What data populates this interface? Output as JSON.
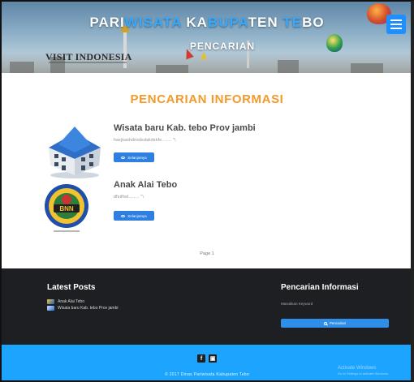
{
  "header": {
    "brand_parts": [
      {
        "text": "PARI",
        "hl": false
      },
      {
        "text": "WISATA",
        "hl": true
      },
      {
        "text": " KA",
        "hl": false
      },
      {
        "text": "BUPA",
        "hl": true
      },
      {
        "text": "TEN ",
        "hl": false
      },
      {
        "text": "TE",
        "hl": true
      },
      {
        "text": "BO",
        "hl": false
      }
    ],
    "subtitle": "PENCARIAN",
    "visit_logo": "VISIT INDONESIA",
    "menu_icon": "hamburger-menu-icon"
  },
  "main": {
    "heading": "PENCARIAN INFORMASI",
    "articles": [
      {
        "title": "Wisata baru Kab. tebo Prov jambi",
        "excerpt": "hasjkashdnsdsdakdskfe....... \"\\",
        "button": "Selanjutnya",
        "thumb": "building-icon"
      },
      {
        "title": "Anak Alai Tebo",
        "excerpt": "dfsdfsd........ \"\\",
        "button": "Selanjutnya",
        "thumb": "bnn-logo-icon"
      }
    ],
    "pagination": "Page 1"
  },
  "footer": {
    "latest_title": "Latest Posts",
    "posts": [
      "Anak Alai Tebo",
      "Wisata baru Kab. tebo Prov jambi"
    ],
    "search_title": "Pencarian Informasi",
    "search_placeholder": "Masukkan Keyword",
    "search_button": "Pencarian",
    "social": [
      "f",
      "▣"
    ],
    "copyright": "© 2017 Dinas Pariwisata Kabupaten Tebo",
    "activate_title": "Activate Windows",
    "activate_sub": "Go to Settings to activate Windows."
  },
  "colors": {
    "accent_orange": "#f39a2b",
    "brand_blue": "#1da4ff",
    "button_blue": "#2f7fe0",
    "footer_dark": "#1e1f22"
  }
}
